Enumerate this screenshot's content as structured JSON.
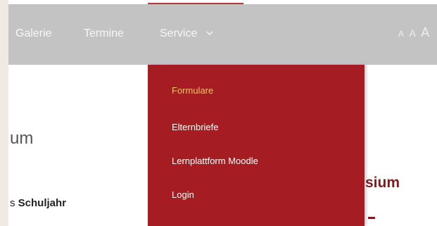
{
  "nav": {
    "items": [
      {
        "label": "Galerie"
      },
      {
        "label": "Termine"
      },
      {
        "label": "Service"
      }
    ]
  },
  "font_sizer": {
    "small": "A",
    "medium": "A",
    "large": "A"
  },
  "dropdown": {
    "items": [
      {
        "label": "Formulare",
        "active": true
      },
      {
        "label": "Elternbriefe"
      },
      {
        "label": "Lernplattform Moodle"
      },
      {
        "label": "Login"
      }
    ]
  },
  "content": {
    "heading_fragment": "um",
    "text_prefix": "s ",
    "text_bold": "Schuljahr",
    "right_title_fragment": "sium"
  },
  "colors": {
    "navbar_bg": "#c3c3c3",
    "dropdown_bg": "#a51d22",
    "active_item": "#f3c16b",
    "accent_dark_red": "#7e1c20"
  },
  "icons": {
    "service_chevron": "chevron-down-icon"
  }
}
